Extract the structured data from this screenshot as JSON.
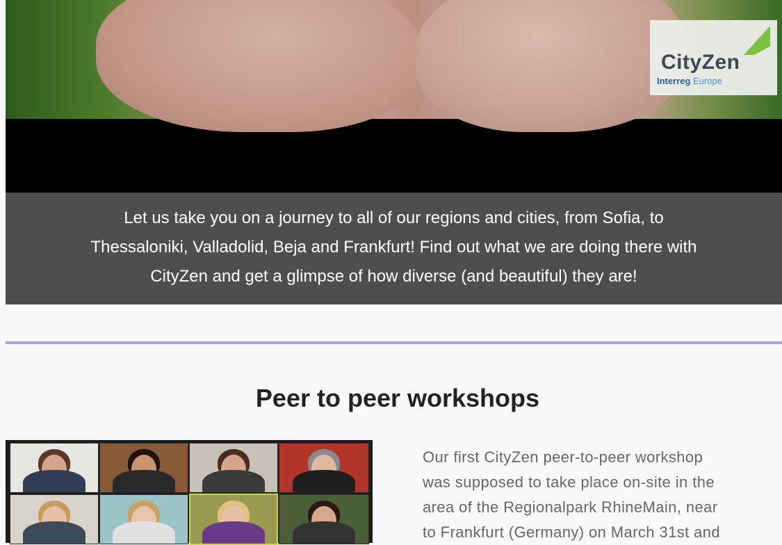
{
  "video": {
    "logo_title": "CityZen",
    "logo_sub_brand": "Interreg",
    "logo_sub_rest": " Europe"
  },
  "caption": {
    "lines": [
      "Let us take you on a journey to all of our regions and cities, from Sofia, to",
      "Thessaloniki, Valladolid, Beja and Frankfurt! Find out what we are doing there with",
      "CityZen and get a glimpse of how diverse (and beautiful) they are!"
    ]
  },
  "section": {
    "heading": "Peer to peer workshops",
    "article_lines": [
      "Our first CityZen peer-to-peer workshop",
      "was supposed to take place on-site in the",
      "area of the Regionalpark RhineMain, near",
      "to Frankfurt (Germany) on March 31st and"
    ]
  },
  "colors": {
    "caption_bg": "#4e4e4e",
    "divider": "#9aa6e2",
    "logo_green": "#7cc242",
    "logo_blue": "#4a8fd0"
  }
}
